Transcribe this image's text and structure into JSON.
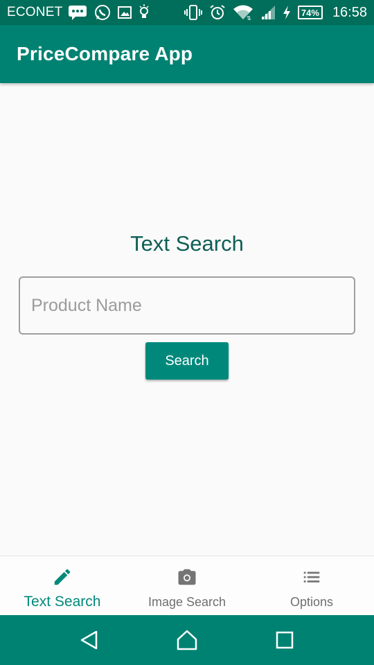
{
  "status_bar": {
    "carrier": "ECONET",
    "battery_percent": "74%",
    "time": "16:58",
    "icons_left": [
      "message-icon",
      "whatsapp-icon",
      "image-icon",
      "lightbulb-icon"
    ],
    "icons_right": [
      "vibrate-icon",
      "alarm-icon",
      "wifi-icon",
      "signal-icon",
      "charging-icon",
      "battery-icon"
    ]
  },
  "app_bar": {
    "title": "PriceCompare App"
  },
  "main": {
    "section_title": "Text Search",
    "search_input": {
      "placeholder": "Product Name",
      "value": ""
    },
    "search_button_label": "Search"
  },
  "bottom_nav": {
    "items": [
      {
        "label": "Text Search",
        "icon": "pencil-icon",
        "active": true
      },
      {
        "label": "Image Search",
        "icon": "camera-icon",
        "active": false
      },
      {
        "label": "Options",
        "icon": "list-icon",
        "active": false
      }
    ]
  },
  "system_nav": {
    "buttons": [
      "back-icon",
      "home-icon",
      "recents-icon"
    ]
  },
  "colors": {
    "status_bar": "#006e5a",
    "app_bar": "#008272",
    "accent": "#00897b",
    "title_text": "#0f5e55",
    "inactive_nav": "#6f6f6f"
  }
}
